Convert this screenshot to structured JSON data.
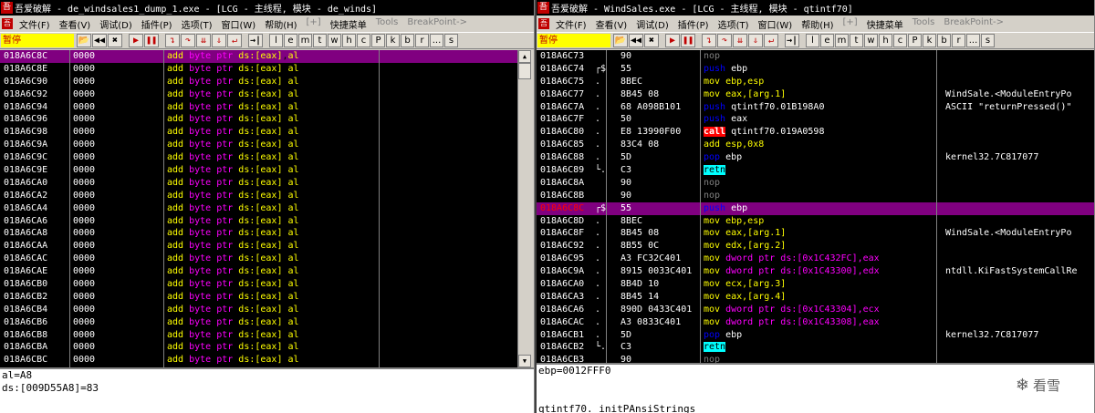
{
  "left": {
    "title": "吾爱破解 - de_windsales1_dump_1.exe - [LCG -  主线程, 模块 - de_winds]",
    "menu": [
      {
        "label": "文件(F)",
        "dim": false
      },
      {
        "label": "查看(V)",
        "dim": false
      },
      {
        "label": "调试(D)",
        "dim": false
      },
      {
        "label": "插件(P)",
        "dim": false
      },
      {
        "label": "选项(T)",
        "dim": false
      },
      {
        "label": "窗口(W)",
        "dim": false
      },
      {
        "label": "帮助(H)",
        "dim": false
      },
      {
        "label": "[+]",
        "dim": true
      },
      {
        "label": "快捷菜单",
        "dim": false
      },
      {
        "label": "Tools",
        "dim": true
      },
      {
        "label": "BreakPoint->",
        "dim": true
      }
    ],
    "status": "暂停",
    "rows": [
      {
        "addr": "018A6C8C",
        "hex": "0000",
        "sel": true
      },
      {
        "addr": "018A6C8E",
        "hex": "0000"
      },
      {
        "addr": "018A6C90",
        "hex": "0000"
      },
      {
        "addr": "018A6C92",
        "hex": "0000"
      },
      {
        "addr": "018A6C94",
        "hex": "0000"
      },
      {
        "addr": "018A6C96",
        "hex": "0000"
      },
      {
        "addr": "018A6C98",
        "hex": "0000"
      },
      {
        "addr": "018A6C9A",
        "hex": "0000"
      },
      {
        "addr": "018A6C9C",
        "hex": "0000"
      },
      {
        "addr": "018A6C9E",
        "hex": "0000"
      },
      {
        "addr": "018A6CA0",
        "hex": "0000"
      },
      {
        "addr": "018A6CA2",
        "hex": "0000"
      },
      {
        "addr": "018A6CA4",
        "hex": "0000"
      },
      {
        "addr": "018A6CA6",
        "hex": "0000"
      },
      {
        "addr": "018A6CA8",
        "hex": "0000"
      },
      {
        "addr": "018A6CAA",
        "hex": "0000"
      },
      {
        "addr": "018A6CAC",
        "hex": "0000"
      },
      {
        "addr": "018A6CAE",
        "hex": "0000"
      },
      {
        "addr": "018A6CB0",
        "hex": "0000"
      },
      {
        "addr": "018A6CB2",
        "hex": "0000"
      },
      {
        "addr": "018A6CB4",
        "hex": "0000"
      },
      {
        "addr": "018A6CB6",
        "hex": "0000"
      },
      {
        "addr": "018A6CB8",
        "hex": "0000"
      },
      {
        "addr": "018A6CBA",
        "hex": "0000"
      },
      {
        "addr": "018A6CBC",
        "hex": "0000"
      }
    ],
    "instr": {
      "op": "add",
      "size": "byte ptr",
      "mem": "ds:[eax]",
      "reg": "al"
    },
    "info": [
      "al=A8",
      "ds:[009D55A8]=83"
    ]
  },
  "right": {
    "title": "吾爱破解 - WindSales.exe - [LCG -  主线程, 模块 - qtintf70]",
    "menu": [
      {
        "label": "文件(F)",
        "dim": false
      },
      {
        "label": "查看(V)",
        "dim": false
      },
      {
        "label": "调试(D)",
        "dim": false
      },
      {
        "label": "插件(P)",
        "dim": false
      },
      {
        "label": "选项(T)",
        "dim": false
      },
      {
        "label": "窗口(W)",
        "dim": false
      },
      {
        "label": "帮助(H)",
        "dim": false
      },
      {
        "label": "[+]",
        "dim": true
      },
      {
        "label": "快捷菜单",
        "dim": false
      },
      {
        "label": "Tools",
        "dim": true
      },
      {
        "label": "BreakPoint->",
        "dim": true
      }
    ],
    "status": "暂停",
    "rows": [
      {
        "addr": "018A6C73",
        "mark": "",
        "hex": "90",
        "mn": "nop",
        "ops": "",
        "cls": "m-nop",
        "cmt": ""
      },
      {
        "addr": "018A6C74",
        "mark": "┌$",
        "hex": "55",
        "mn": "push",
        "ops": "ebp",
        "cls": "m-push",
        "cmt": ""
      },
      {
        "addr": "018A6C75",
        "mark": ".",
        "hex": "8BEC",
        "mn": "mov",
        "ops": "ebp,esp",
        "cls": "m-yel",
        "cmt": ""
      },
      {
        "addr": "018A6C77",
        "mark": ".",
        "hex": "8B45 08",
        "mn": "mov",
        "ops": "eax,[arg.1]",
        "cls": "m-yel",
        "cmt": "WindSale.<ModuleEntryPo"
      },
      {
        "addr": "018A6C7A",
        "mark": ".",
        "hex": "68 A098B101",
        "mn": "push",
        "ops": "qtintf70.01B198A0",
        "cls": "m-push",
        "cmt": "ASCII \"returnPressed()\""
      },
      {
        "addr": "018A6C7F",
        "mark": ".",
        "hex": "50",
        "mn": "push",
        "ops": "eax",
        "cls": "m-push",
        "cmt": ""
      },
      {
        "addr": "018A6C80",
        "mark": ".",
        "hex": "E8 13990F00",
        "mn": "call",
        "ops": "qtintf70.019A0598",
        "cls": "m-call",
        "cmt": ""
      },
      {
        "addr": "018A6C85",
        "mark": ".",
        "hex": "83C4 08",
        "mn": "add",
        "ops": "esp,0x8",
        "cls": "m-yel",
        "cmt": ""
      },
      {
        "addr": "018A6C88",
        "mark": ".",
        "hex": "5D",
        "mn": "pop",
        "ops": "ebp",
        "cls": "m-push",
        "cmt": "kernel32.7C817077"
      },
      {
        "addr": "018A6C89",
        "mark": "└.",
        "hex": "C3",
        "mn": "retn",
        "ops": "",
        "cls": "m-retn",
        "cmt": ""
      },
      {
        "addr": "018A6C8A",
        "mark": "",
        "hex": "90",
        "mn": "nop",
        "ops": "",
        "cls": "m-nop",
        "cmt": ""
      },
      {
        "addr": "018A6C8B",
        "mark": "",
        "hex": "90",
        "mn": "nop",
        "ops": "",
        "cls": "m-nop",
        "cmt": ""
      },
      {
        "addr": "018A6C8C",
        "mark": "┌$",
        "hex": "55",
        "mn": "push",
        "ops": "ebp",
        "cls": "m-push",
        "cmt": "",
        "sel": true
      },
      {
        "addr": "018A6C8D",
        "mark": ".",
        "hex": "8BEC",
        "mn": "mov",
        "ops": "ebp,esp",
        "cls": "m-yel",
        "cmt": ""
      },
      {
        "addr": "018A6C8F",
        "mark": ".",
        "hex": "8B45 08",
        "mn": "mov",
        "ops": "eax,[arg.1]",
        "cls": "m-yel",
        "cmt": "WindSale.<ModuleEntryPo"
      },
      {
        "addr": "018A6C92",
        "mark": ".",
        "hex": "8B55 0C",
        "mn": "mov",
        "ops": "edx,[arg.2]",
        "cls": "m-yel",
        "cmt": ""
      },
      {
        "addr": "018A6C95",
        "mark": ".",
        "hex": "A3 FC32C401",
        "mn": "mov",
        "ops": "dword ptr ds:[0x1C432FC],eax",
        "cls": "m-yel",
        "cmt": ""
      },
      {
        "addr": "018A6C9A",
        "mark": ".",
        "hex": "8915 0033C401",
        "mn": "mov",
        "ops": "dword ptr ds:[0x1C43300],edx",
        "cls": "m-yel",
        "cmt": "ntdll.KiFastSystemCallRe"
      },
      {
        "addr": "018A6CA0",
        "mark": ".",
        "hex": "8B4D 10",
        "mn": "mov",
        "ops": "ecx,[arg.3]",
        "cls": "m-yel",
        "cmt": ""
      },
      {
        "addr": "018A6CA3",
        "mark": ".",
        "hex": "8B45 14",
        "mn": "mov",
        "ops": "eax,[arg.4]",
        "cls": "m-yel",
        "cmt": ""
      },
      {
        "addr": "018A6CA6",
        "mark": ".",
        "hex": "890D 0433C401",
        "mn": "mov",
        "ops": "dword ptr ds:[0x1C43304],ecx",
        "cls": "m-yel",
        "cmt": ""
      },
      {
        "addr": "018A6CAC",
        "mark": ".",
        "hex": "A3 0833C401",
        "mn": "mov",
        "ops": "dword ptr ds:[0x1C43308],eax",
        "cls": "m-yel",
        "cmt": ""
      },
      {
        "addr": "018A6CB1",
        "mark": ".",
        "hex": "5D",
        "mn": "pop",
        "ops": "ebp",
        "cls": "m-push",
        "cmt": "kernel32.7C817077"
      },
      {
        "addr": "018A6CB2",
        "mark": "└.",
        "hex": "C3",
        "mn": "retn",
        "ops": "",
        "cls": "m-retn",
        "cmt": ""
      },
      {
        "addr": "018A6CB3",
        "mark": "",
        "hex": "90",
        "mn": "nop",
        "ops": "",
        "cls": "m-nop",
        "cmt": ""
      }
    ],
    "info": [
      "ebp=0012FFF0",
      "",
      "",
      "qtintf70._initPAnsiStrings"
    ],
    "logo": "看雪"
  },
  "toolbar": {
    "buttons": [
      {
        "g": "📂",
        "c": "k",
        "name": "open-icon"
      },
      {
        "g": "◀◀",
        "c": "k",
        "name": "rewind-icon"
      },
      {
        "g": "✖",
        "c": "k",
        "name": "close-icon"
      },
      {
        "g": "▶",
        "c": "r",
        "name": "run-icon"
      },
      {
        "g": "❚❚",
        "c": "r",
        "name": "pause-icon"
      },
      {
        "g": "↴",
        "c": "r",
        "name": "step-into-icon"
      },
      {
        "g": "↷",
        "c": "r",
        "name": "step-over-icon"
      },
      {
        "g": "⇊",
        "c": "r",
        "name": "trace-into-icon"
      },
      {
        "g": "⇓",
        "c": "r",
        "name": "trace-over-icon"
      },
      {
        "g": "↵",
        "c": "r",
        "name": "execute-till-return-icon"
      },
      {
        "g": "→|",
        "c": "k",
        "name": "goto-icon"
      }
    ],
    "letters": [
      "l",
      "e",
      "m",
      "t",
      "w",
      "h",
      "c",
      "P",
      "k",
      "b",
      "r",
      "...",
      "s"
    ]
  }
}
